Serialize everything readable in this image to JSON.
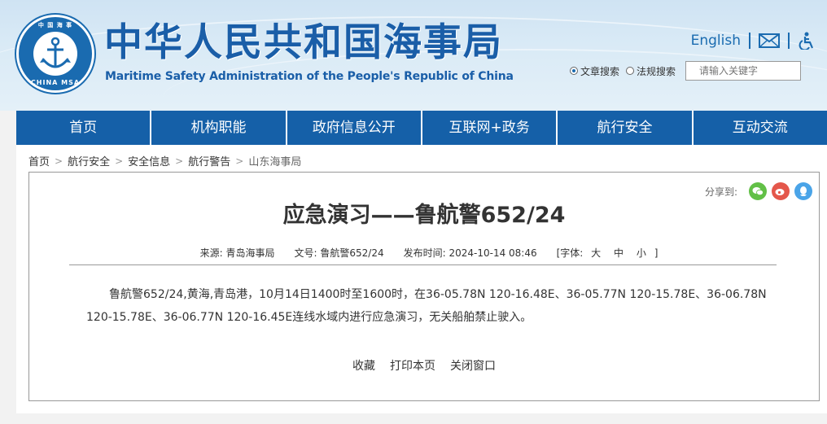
{
  "header": {
    "logo": {
      "ring_top": "中 国 海 事",
      "ring_bottom": "CHINA MSA",
      "icon": "anchor-emblem"
    },
    "title_cn": "中华人民共和国海事局",
    "title_en": "Maritime Safety Administration of the People's Republic of China",
    "english_link": "English",
    "mail_icon": "mail-icon",
    "accessibility_icon": "accessibility-icon",
    "search": {
      "option_article": "文章搜索",
      "option_law": "法规搜索",
      "selected": "文章搜索",
      "placeholder": "请输入关键字"
    }
  },
  "nav": {
    "items": [
      {
        "label": "首页"
      },
      {
        "label": "机构职能"
      },
      {
        "label": "政府信息公开"
      },
      {
        "label": "互联网+政务"
      },
      {
        "label": "航行安全"
      },
      {
        "label": "互动交流"
      }
    ]
  },
  "breadcrumb": [
    "首页",
    "航行安全",
    "安全信息",
    "航行警告",
    "山东海事局"
  ],
  "share": {
    "label": "分享到:",
    "icons": [
      "wechat-icon",
      "weibo-icon",
      "qq-icon"
    ]
  },
  "article": {
    "title": "应急演习——鲁航警652/24",
    "source_label": "来源:",
    "source": "青岛海事局",
    "doc_no_label": "文号:",
    "doc_no": "鲁航警652/24",
    "publish_label": "发布时间:",
    "publish_time": "2024-10-14 08:46",
    "font_label": "[字体:",
    "font_large": "大",
    "font_medium": "中",
    "font_small": "小",
    "font_close": "]",
    "body": "鲁航警652/24,黄海,青岛港，10月14日1400时至1600时，在36-05.78N 120-16.48E、36-05.77N 120-15.78E、36-06.78N 120-15.78E、36-06.77N 120-16.45E连线水域内进行应急演习，无关船舶禁止驶入。",
    "actions": {
      "collect": "收藏",
      "print": "打印本页",
      "close": "关闭窗口"
    }
  },
  "colors": {
    "brand": "#1560a8",
    "title": "#1a5ea8"
  }
}
